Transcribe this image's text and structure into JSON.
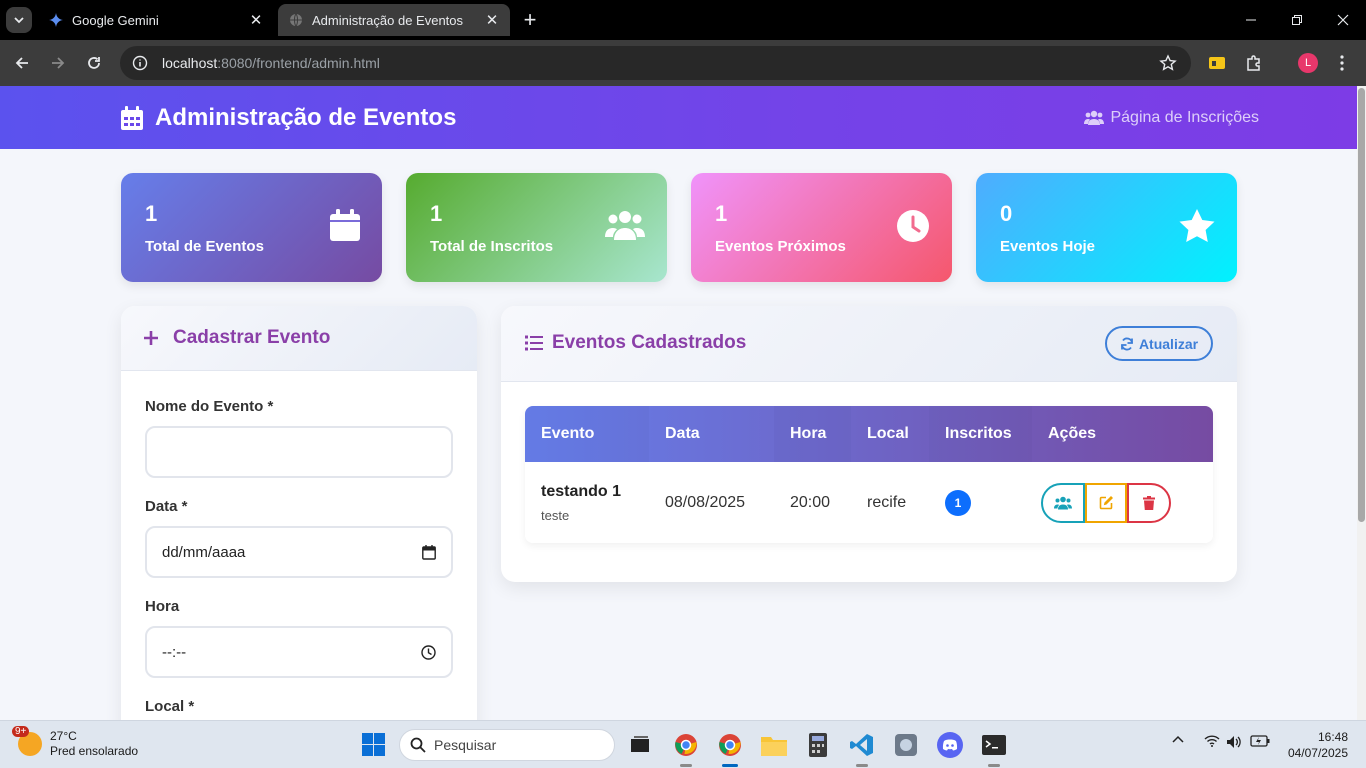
{
  "browser": {
    "tabs": [
      {
        "title": "Google Gemini",
        "active": false
      },
      {
        "title": "Administração de Eventos",
        "active": true
      }
    ],
    "url_host": "localhost",
    "url_path": ":8080/frontend/admin.html",
    "profile_initial": "L"
  },
  "header": {
    "title": "Administração de Eventos",
    "nav_link": "Página de Inscrições"
  },
  "stats": [
    {
      "value": "1",
      "label": "Total de Eventos",
      "icon": "calendar-icon"
    },
    {
      "value": "1",
      "label": "Total de Inscritos",
      "icon": "users-icon"
    },
    {
      "value": "1",
      "label": "Eventos Próximos",
      "icon": "clock-icon"
    },
    {
      "value": "0",
      "label": "Eventos Hoje",
      "icon": "star-icon"
    }
  ],
  "form": {
    "title": "Cadastrar Evento",
    "fields": [
      {
        "label": "Nome do Evento *",
        "value": ""
      },
      {
        "label": "Data *",
        "value": "dd/mm/aaaa"
      },
      {
        "label": "Hora",
        "value": "--:--"
      },
      {
        "label": "Local *"
      }
    ]
  },
  "events_list": {
    "title": "Eventos Cadastrados",
    "refresh_label": "Atualizar",
    "columns": [
      "Evento",
      "Data",
      "Hora",
      "Local",
      "Inscritos",
      "Ações"
    ],
    "rows": [
      {
        "name": "testando 1",
        "description": "teste",
        "date": "08/08/2025",
        "time": "20:00",
        "location": "recife",
        "registrations": "1"
      }
    ]
  },
  "taskbar": {
    "weather_temp": "27°C",
    "weather_desc": "Pred ensolarado",
    "weather_badge": "9+",
    "search_placeholder": "Pesquisar",
    "time": "16:48",
    "date": "04/07/2025"
  },
  "colors": {
    "header_start": "#5b52ee",
    "header_end": "#7d3ce6",
    "accent_purple": "#8a3fa8",
    "badge_blue": "#0d6efd",
    "action_info": "#17a2b8",
    "action_warning": "#f0a500",
    "action_danger": "#dc3545"
  }
}
